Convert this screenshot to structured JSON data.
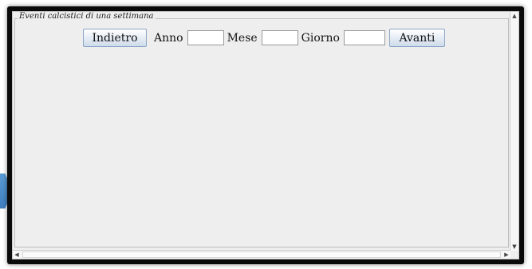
{
  "panel": {
    "title": "Eventi calcistici di una settimana"
  },
  "toolbar": {
    "back_label": "Indietro",
    "year_label": "Anno",
    "year_value": "",
    "month_label": "Mese",
    "month_value": "",
    "day_label": "Giorno",
    "day_value": "",
    "next_label": "Avanti"
  },
  "icons": {
    "scroll_up": "arrow-up-icon",
    "scroll_down": "arrow-down-icon",
    "scroll_left": "arrow-left-icon",
    "scroll_right": "arrow-right-icon",
    "side_arrow": "chevron-right-icon"
  },
  "colors": {
    "side_arrow": "#4a8ccb",
    "button_border": "#8aa6c6"
  }
}
